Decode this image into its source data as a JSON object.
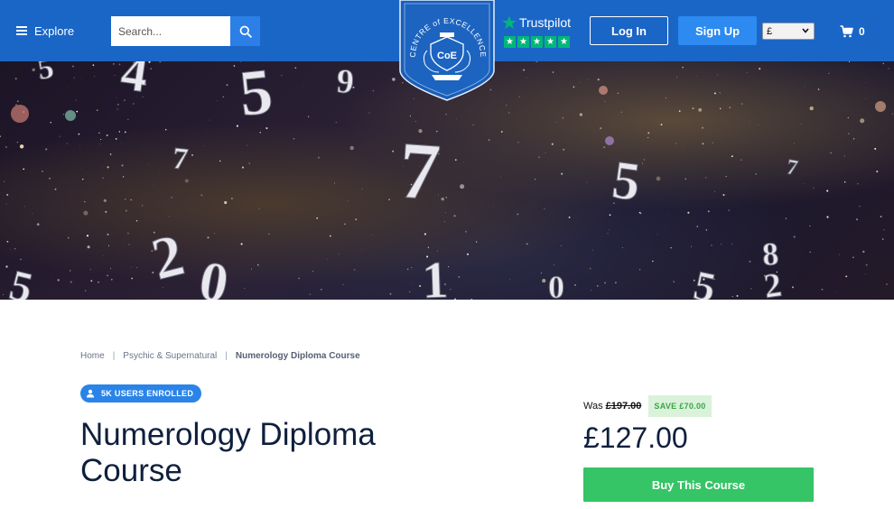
{
  "header": {
    "explore_label": "Explore",
    "search_placeholder": "Search...",
    "logo_text_top": "CENTRE of EXCELLENCE",
    "logo_initials": "CoE",
    "trustpilot_label": "Trustpilot",
    "trustpilot_rating_stars": 5,
    "login_label": "Log In",
    "signup_label": "Sign Up",
    "currency_selected": "£",
    "cart_count": "0"
  },
  "hero": {
    "numerals": [
      "5",
      "4",
      "5",
      "9",
      "7",
      "7",
      "2",
      "0",
      "5",
      "7",
      "8",
      "1",
      "0",
      "5",
      "2",
      "5"
    ]
  },
  "breadcrumb": {
    "items": [
      "Home",
      "Psychic & Supernatural"
    ],
    "current": "Numerology Diploma Course"
  },
  "course": {
    "enrolled_label": "5K USERS ENROLLED",
    "title": "Numerology Diploma Course"
  },
  "pricing": {
    "was_label": "Was",
    "old_price": "£197.00",
    "save_label": "SAVE £70.00",
    "price": "£127.00",
    "buy_label": "Buy This Course"
  },
  "colors": {
    "header_bg": "#1a66c7",
    "primary": "#2a84e8",
    "buy_green": "#35c466",
    "save_bg": "#d9f2d9",
    "save_text": "#3ba54a",
    "trustpilot_green": "#00b67a",
    "title_navy": "#0f1f3d"
  },
  "icons": {
    "menu": "hamburger-icon",
    "search": "search-icon",
    "cart": "cart-icon",
    "user": "user-icon",
    "star": "star-icon",
    "chevron": "chevron-down-icon"
  }
}
